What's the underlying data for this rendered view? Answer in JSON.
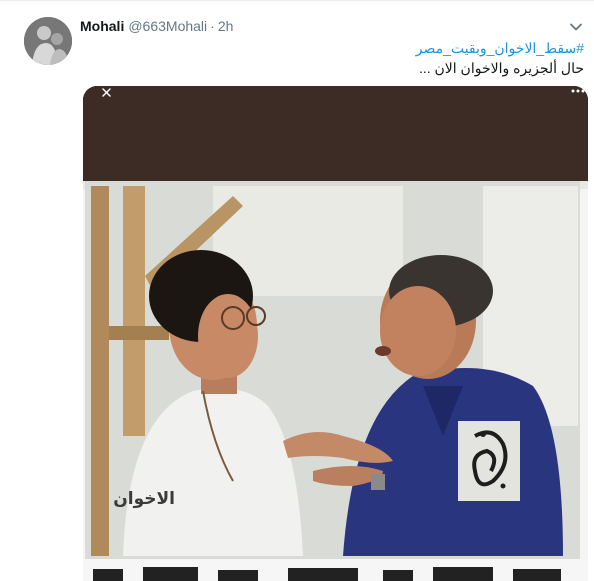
{
  "tweet": {
    "display_name": "Mohali",
    "handle": "@663Mohali",
    "separator": "·",
    "time": "2h",
    "hashtag": "#سقط_الاخوان_وبقيت_مصر",
    "body": "حال ألجزيره والاخوان الان ...",
    "image_caption": "الاخوان"
  },
  "colors": {
    "link": "#1b95e0",
    "muted": "#657786",
    "media_banner": "#3d2b25"
  },
  "icons": {
    "caret": "chevron-down-icon",
    "media_close": "close-icon",
    "media_more": "more-icon",
    "logo": "al-jazeera-logo"
  }
}
